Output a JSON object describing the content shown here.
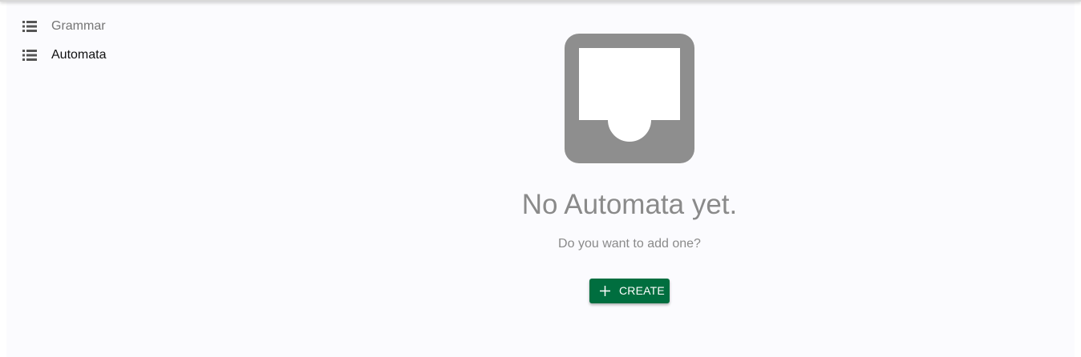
{
  "sidebar": {
    "items": [
      {
        "label": "Grammar",
        "icon": "list-icon",
        "state": "muted"
      },
      {
        "label": "Automata",
        "icon": "list-icon",
        "state": "active"
      }
    ]
  },
  "empty_state": {
    "icon": "inbox-tray-icon",
    "title": "No Automata yet.",
    "subtitle": "Do you want to add one?",
    "button_label": "CREATE",
    "button_icon": "plus-icon"
  },
  "colors": {
    "background": "#fbfbfe",
    "muted_text": "#8a8a8a",
    "icon_gray": "#8e8e8e",
    "button_green": "#006e3f"
  }
}
